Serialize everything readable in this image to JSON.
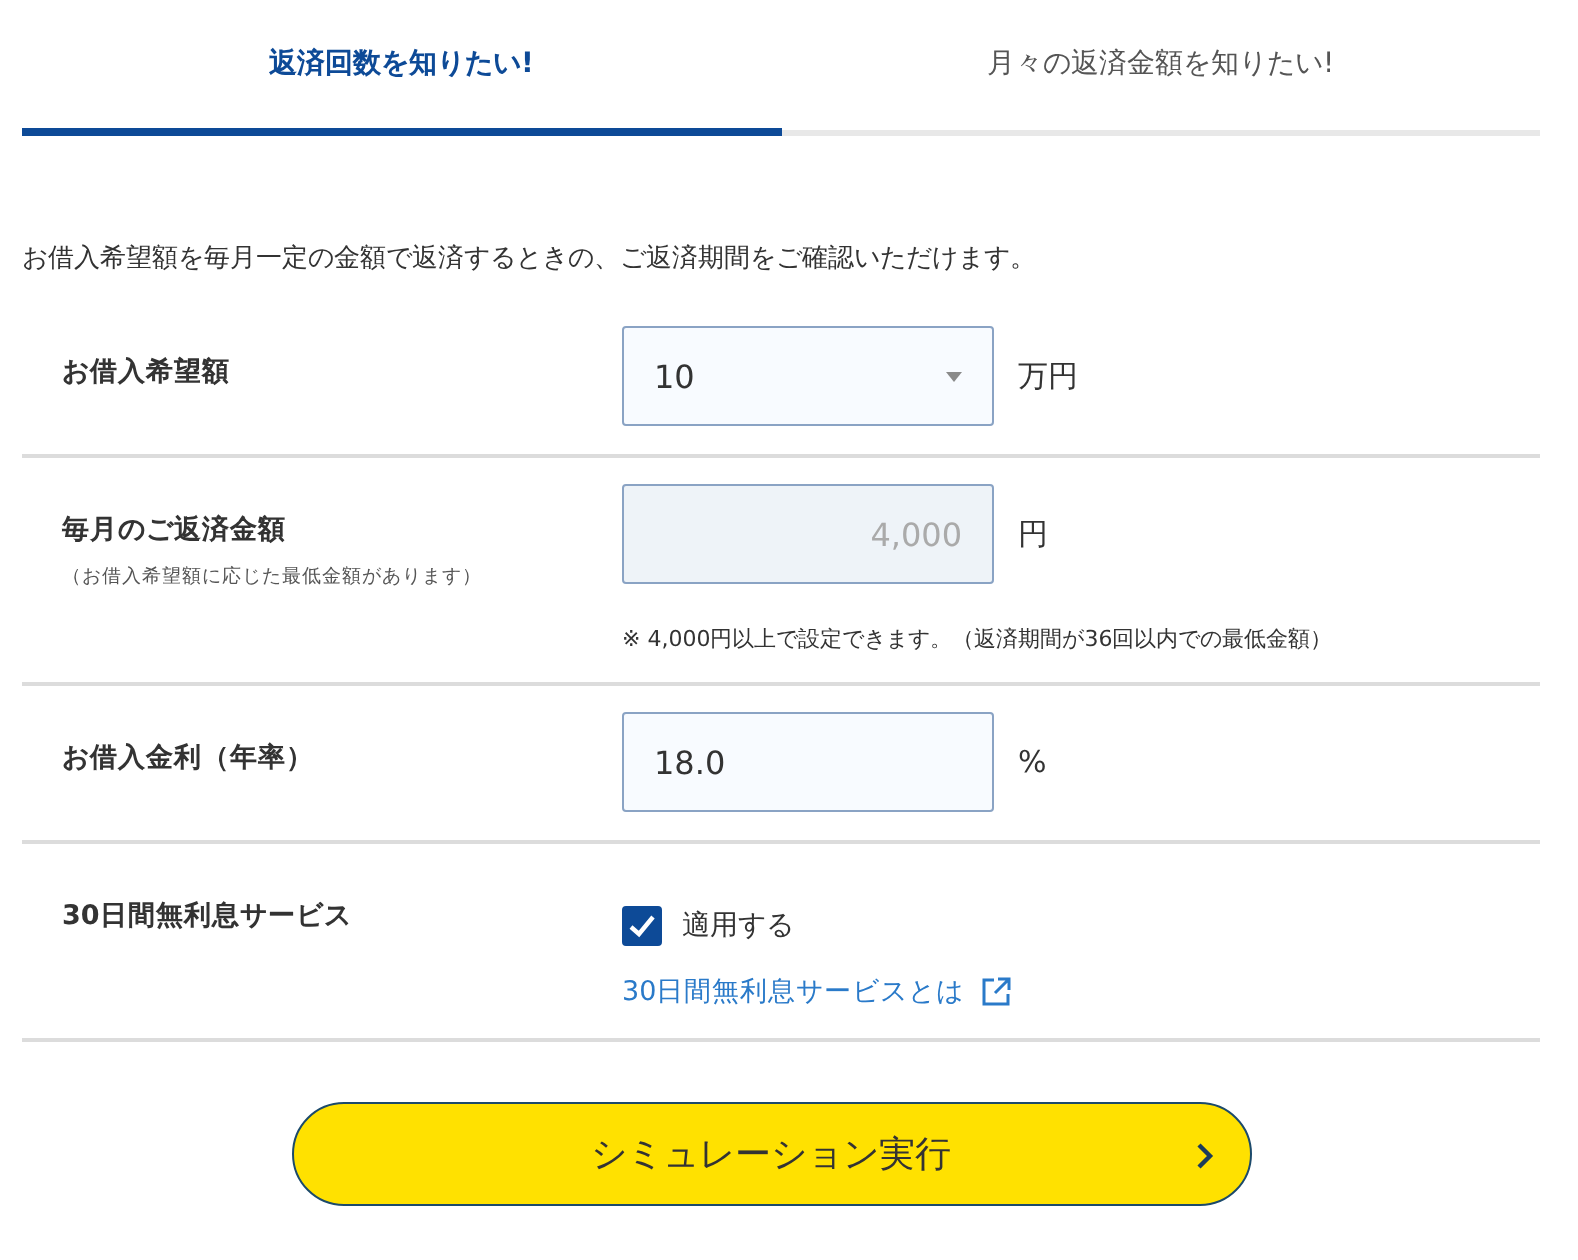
{
  "tabs": [
    {
      "label": "返済回数を知りたい!",
      "selected": true
    },
    {
      "label": "月々の返済金額を知りたい!",
      "selected": false
    }
  ],
  "intro": "お借入希望額を毎月一定の金額で返済するときの、ご返済期間をご確認いただけます。",
  "rows": [
    {
      "kind": "select",
      "label": "お借入希望額",
      "value": "10",
      "unit": "万円"
    },
    {
      "kind": "number",
      "label": "毎月のご返済金額",
      "note": "（お借入希望額に応じた最低金額があります）",
      "value": "4,000",
      "unit": "円",
      "disabled": true,
      "hint": "※ 4,000円以上で設定できます。（返済期間が36回以内での最低金額）"
    },
    {
      "kind": "number",
      "label": "お借入金利（年率）",
      "value": "18.0",
      "unit": "%",
      "disabled": false
    },
    {
      "kind": "checkbox",
      "label": "30日間無利息サービス",
      "option": "適用する",
      "checked": true,
      "link": "30日間無利息サービスとは"
    }
  ],
  "submit": "シミュレーション実行"
}
